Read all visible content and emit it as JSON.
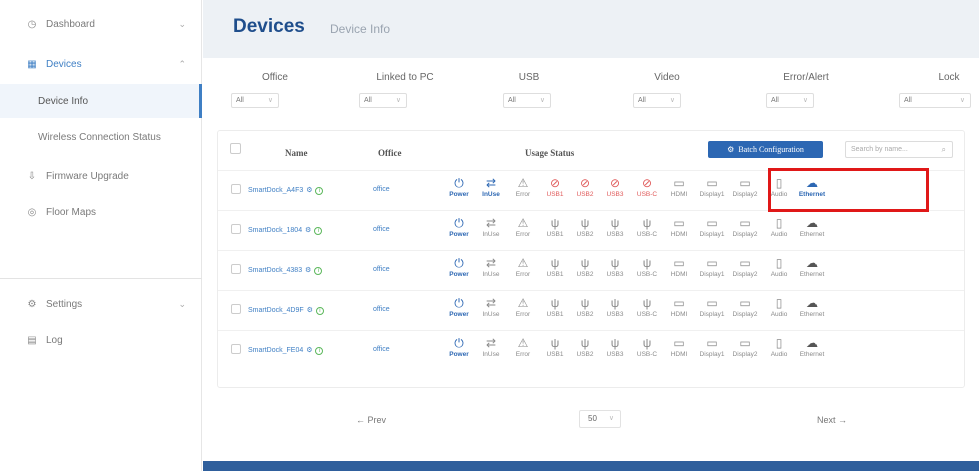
{
  "sidebar": {
    "dashboard": "Dashboard",
    "devices": "Devices",
    "device_info": "Device Info",
    "wireless": "Wireless Connection Status",
    "firmware": "Firmware Upgrade",
    "floor_maps": "Floor Maps",
    "settings": "Settings",
    "log": "Log"
  },
  "header": {
    "title": "Devices",
    "subtitle": "Device Info"
  },
  "filters": [
    {
      "label": "Office",
      "value": "All"
    },
    {
      "label": "Linked to PC",
      "value": "All"
    },
    {
      "label": "USB",
      "value": "All"
    },
    {
      "label": "Video",
      "value": "All"
    },
    {
      "label": "Error/Alert",
      "value": "All"
    },
    {
      "label": "Lock",
      "value": "All"
    }
  ],
  "table": {
    "headers": {
      "name": "Name",
      "office": "Office",
      "usage": "Usage Status"
    },
    "batch_button": "Batch Configuration",
    "search_placeholder": "Search by name...",
    "status_labels": [
      "Power",
      "InUse",
      "Error",
      "USB1",
      "USB2",
      "USB3",
      "USB-C",
      "HDMI",
      "Display1",
      "Display2",
      "Audio",
      "Ethernet"
    ],
    "rows": [
      {
        "name": "SmartDock_A4F3",
        "office": "office"
      },
      {
        "name": "SmartDock_1804",
        "office": "office"
      },
      {
        "name": "SmartDock_4383",
        "office": "office"
      },
      {
        "name": "SmartDock_4D9F",
        "office": "office"
      },
      {
        "name": "SmartDock_FE04",
        "office": "office"
      }
    ]
  },
  "pagination": {
    "prev": "← Prev",
    "next": "Next →",
    "page_size": "50"
  },
  "colors": {
    "accent": "#2c67b3",
    "title": "#1f4e8c",
    "error": "#e05a5a",
    "highlight": "#e01818"
  }
}
